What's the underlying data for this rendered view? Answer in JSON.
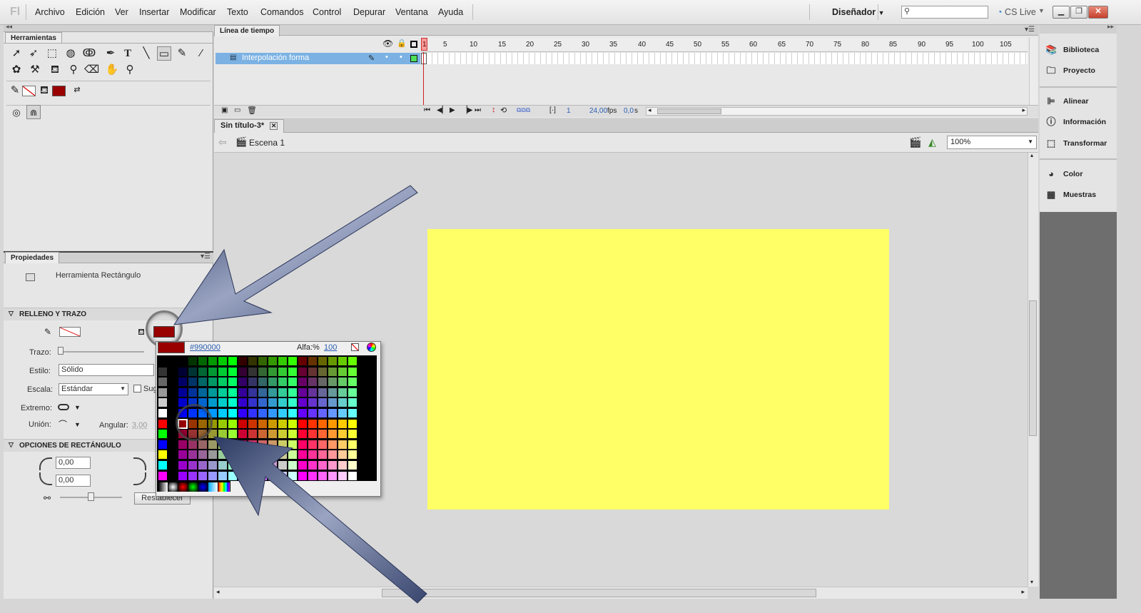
{
  "app": {
    "logo": "Fl"
  },
  "menu": [
    "Archivo",
    "Edición",
    "Ver",
    "Insertar",
    "Modificar",
    "Texto",
    "Comandos",
    "Control",
    "Depurar",
    "Ventana",
    "Ayuda"
  ],
  "toolbar": {
    "workspace": "Diseñador",
    "search_placeholder": "",
    "cslive": "CS Live"
  },
  "tools_panel": {
    "tab": "Herramientas"
  },
  "properties": {
    "tab": "Propiedades",
    "tool_name": "Herramienta Rectángulo",
    "fill_stroke_section": "RELLENO Y TRAZO",
    "stroke_label": "Trazo:",
    "style_label": "Estilo:",
    "style_value": "Sólido",
    "scale_label": "Escala:",
    "scale_value": "Estándar",
    "hint_label": "Sug",
    "cap_label": "Extremo:",
    "join_label": "Unión:",
    "angular_label": "Angular:",
    "angular_value": "3,00",
    "rect_section": "OPCIONES DE RECTÁNGULO",
    "corner1": "0,00",
    "corner2": "0,00",
    "reset_button": "Restablecer"
  },
  "timeline": {
    "tab": "Línea de tiempo",
    "layer_name": "Interpolación forma",
    "ruler": [
      "1",
      "5",
      "10",
      "15",
      "20",
      "25",
      "30",
      "35",
      "40",
      "45",
      "50",
      "55",
      "60",
      "65",
      "70",
      "75",
      "80",
      "85",
      "90",
      "95",
      "100",
      "105"
    ],
    "current_frame": "1",
    "fps": "24,00",
    "fps_unit": "fps",
    "time": "0,0",
    "time_unit": "s"
  },
  "document": {
    "tab": "Sin título-3*",
    "scene": "Escena 1",
    "zoom": "100%",
    "stage_color": "#ffff66"
  },
  "right_panels": [
    "Biblioteca",
    "Proyecto",
    "Alinear",
    "Información",
    "Transformar",
    "Color",
    "Muestras"
  ],
  "swatch_popup": {
    "hex_value": "#990000",
    "alpha_label": "Alfa:%",
    "alpha_value": "100",
    "selected_color": "#990000"
  }
}
